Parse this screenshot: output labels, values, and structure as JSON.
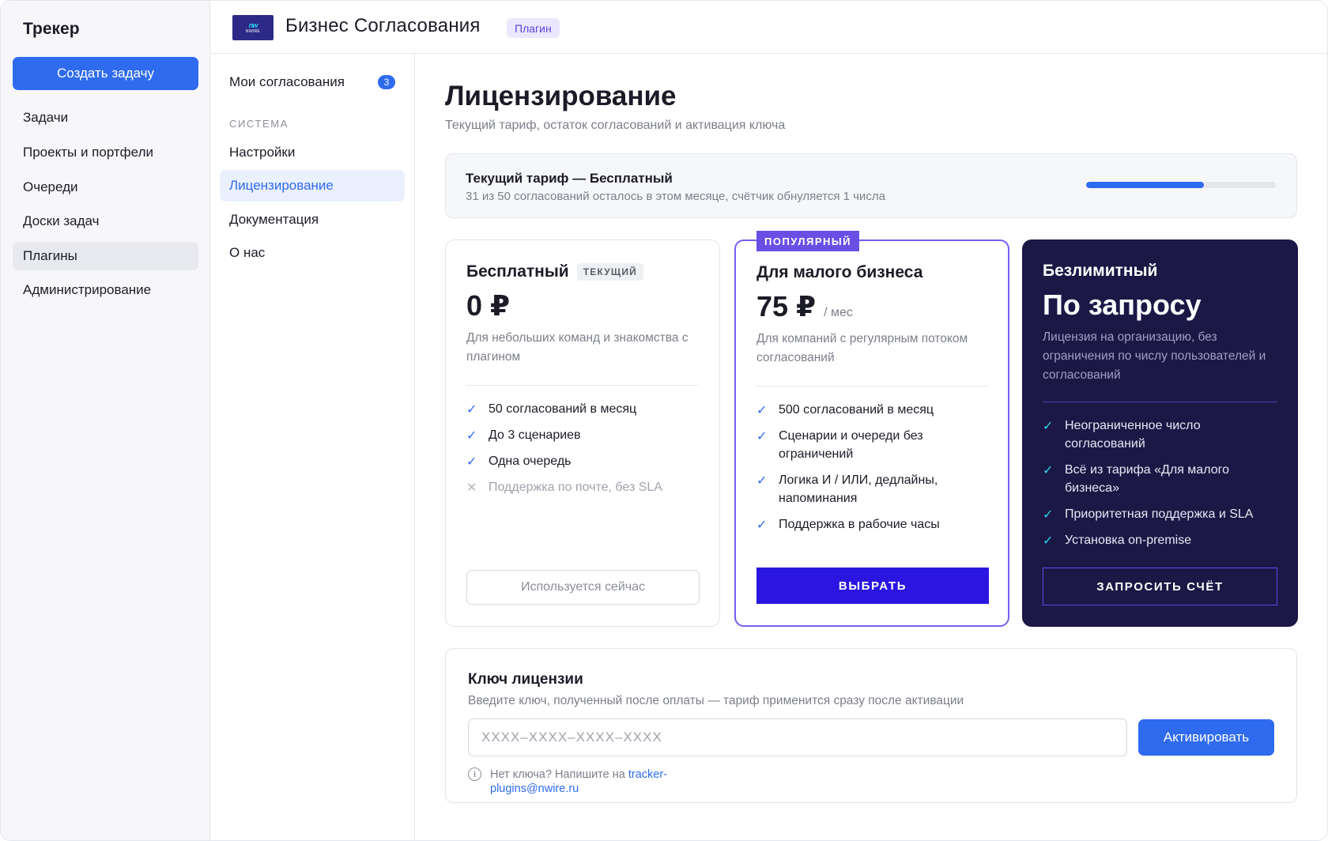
{
  "sidebar": {
    "title": "Трекер",
    "create_button": "Создать задачу",
    "items": [
      {
        "label": "Задачи",
        "active": false
      },
      {
        "label": "Проекты и портфели",
        "active": false
      },
      {
        "label": "Очереди",
        "active": false
      },
      {
        "label": "Доски задач",
        "active": false
      },
      {
        "label": "Плагины",
        "active": true
      },
      {
        "label": "Администрирование",
        "active": false
      }
    ]
  },
  "header": {
    "logo_mark": "nw",
    "logo_text": "NWIRE",
    "title": "Бизнес Согласования",
    "badge": "Плагин"
  },
  "subnav": {
    "my_approvals": {
      "label": "Мои согласования",
      "count": "3"
    },
    "section_label": "СИСТЕМА",
    "items": [
      {
        "label": "Настройки",
        "active": false
      },
      {
        "label": "Лицензирование",
        "active": true
      },
      {
        "label": "Документация",
        "active": false
      },
      {
        "label": "О нас",
        "active": false
      }
    ]
  },
  "main": {
    "title": "Лицензирование",
    "subtitle": "Текущий тариф, остаток согласований и активация ключа",
    "current_plan": {
      "title": "Текущий тариф — Бесплатный",
      "subtitle": "31 из 50 согласований осталось в этом месяце, счётчик обнуляется 1 числа",
      "remaining": 31,
      "total": 50
    },
    "plans": {
      "free": {
        "name": "Бесплатный",
        "tag": "ТЕКУЩИЙ",
        "price": "0 ₽",
        "description": "Для небольших команд и знакомства с плагином",
        "features": [
          {
            "text": "50 согласований в месяц",
            "included": true
          },
          {
            "text": "До 3 сценариев",
            "included": true
          },
          {
            "text": "Одна очередь",
            "included": true
          },
          {
            "text": "Поддержка по почте, без SLA",
            "included": false
          }
        ],
        "button": "Используется сейчас"
      },
      "small": {
        "badge": "ПОПУЛЯРНЫЙ",
        "name": "Для малого бизнеса",
        "price": "75 ₽",
        "period": "/ мес",
        "description": "Для компаний с регулярным потоком согласований",
        "features": [
          {
            "text": "500 согласований в месяц",
            "included": true
          },
          {
            "text": "Сценарии и очереди без ограничений",
            "included": true
          },
          {
            "text": "Логика И / ИЛИ, дедлайны, напоминания",
            "included": true
          },
          {
            "text": "Поддержка в рабочие часы",
            "included": true
          }
        ],
        "button": "ВЫБРАТЬ"
      },
      "unlimited": {
        "name": "Безлимитный",
        "price": "По запросу",
        "description": "Лицензия на организацию, без ограничения по числу пользователей и согласований",
        "features": [
          {
            "text": "Неограниченное число согласований",
            "included": true
          },
          {
            "text": "Всё из тарифа «Для малого бизнеса»",
            "included": true
          },
          {
            "text": "Приоритетная поддержка и SLA",
            "included": true
          },
          {
            "text": "Установка on-premise",
            "included": true
          }
        ],
        "button": "ЗАПРОСИТЬ СЧЁТ"
      }
    },
    "license_key": {
      "title": "Ключ лицензии",
      "subtitle": "Введите ключ, полученный после оплаты — тариф применится сразу после активации",
      "placeholder": "XXXX–XXXX–XXXX–XXXX",
      "value": "",
      "button": "Активировать",
      "help_text": "Нет ключа? Напишите на ",
      "help_email": "tracker-plugins@nwire.ru"
    }
  },
  "colors": {
    "accent": "#2f6bee",
    "purple": "#6a4fe6",
    "choose_button": "#2a16e0",
    "dark_card": "#1b1846",
    "check_on_dark": "#2bd3e4"
  },
  "icons": {
    "check": "check-icon",
    "cross": "cross-icon",
    "info": "info-icon"
  }
}
